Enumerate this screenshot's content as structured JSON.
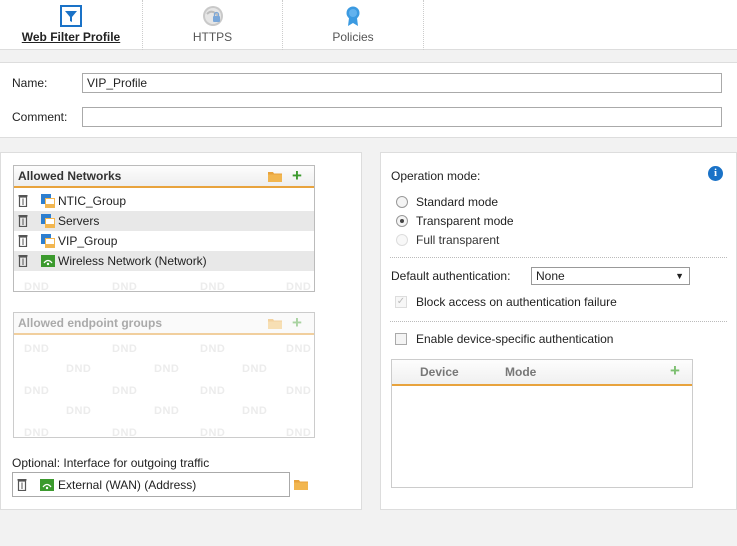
{
  "tabs": [
    {
      "label": "Web Filter Profile",
      "icon": "filter-icon",
      "active": true
    },
    {
      "label": "HTTPS",
      "icon": "https-icon",
      "active": false
    },
    {
      "label": "Policies",
      "icon": "policies-icon",
      "active": false
    }
  ],
  "form": {
    "name_label": "Name:",
    "name_value": "VIP_Profile",
    "comment_label": "Comment:",
    "comment_value": ""
  },
  "allowed_networks": {
    "title": "Allowed Networks",
    "items": [
      {
        "label": "NTIC_Group",
        "icon": "network-group-icon"
      },
      {
        "label": "Servers",
        "icon": "network-group-icon"
      },
      {
        "label": "VIP_Group",
        "icon": "network-group-icon"
      },
      {
        "label": "Wireless Network (Network)",
        "icon": "wireless-network-icon"
      }
    ],
    "placeholder": "DND"
  },
  "endpoint_groups": {
    "title": "Allowed endpoint groups",
    "placeholder": "DND"
  },
  "outgoing": {
    "label": "Optional: Interface for outgoing traffic",
    "value": "External (WAN) (Address)"
  },
  "operation": {
    "label": "Operation mode:",
    "options": [
      {
        "label": "Standard mode",
        "selected": false,
        "enabled": true
      },
      {
        "label": "Transparent mode",
        "selected": true,
        "enabled": true
      },
      {
        "label": "Full transparent",
        "selected": false,
        "enabled": false
      }
    ]
  },
  "auth": {
    "label": "Default authentication:",
    "value": "None",
    "block_label": "Block access on authentication failure",
    "block_checked": true,
    "device_label": "Enable device-specific authentication",
    "device_checked": false
  },
  "device_table": {
    "columns": [
      "Device",
      "Mode"
    ]
  },
  "colors": {
    "accent_orange": "#e8a33d",
    "add_green": "#3c9a2e",
    "info_blue": "#1a72c7"
  }
}
